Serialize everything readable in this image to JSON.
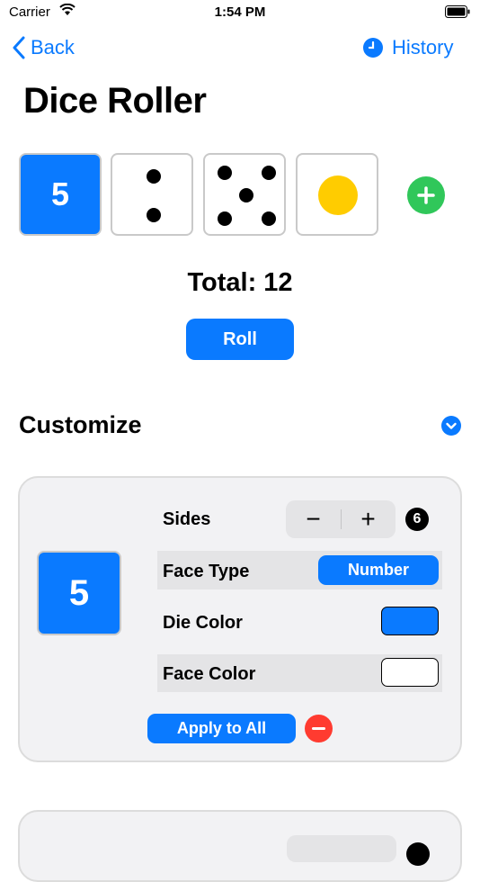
{
  "status": {
    "carrier": "Carrier",
    "time": "1:54 PM"
  },
  "nav": {
    "back_label": "Back",
    "history_label": "History"
  },
  "title": "Dice Roller",
  "dice": [
    {
      "type": "number",
      "value": "5",
      "color": "#0a7aff"
    },
    {
      "type": "pips",
      "value": 2
    },
    {
      "type": "pips",
      "value": 5
    },
    {
      "type": "symbol",
      "icon": "sun-icon",
      "color": "#ffcc00"
    }
  ],
  "total_label": "Total: 12",
  "roll_label": "Roll",
  "customize": {
    "heading": "Customize",
    "card": {
      "die_value": "5",
      "sides_label": "Sides",
      "sides_minus": "−",
      "sides_plus": "+",
      "sides_value": "6",
      "face_type_label": "Face Type",
      "face_type_value": "Number",
      "die_color_label": "Die Color",
      "die_color": "#0a7aff",
      "face_color_label": "Face Color",
      "face_color": "#ffffff",
      "apply_label": "Apply to All"
    }
  },
  "colors": {
    "accent": "#0a7aff",
    "add": "#30c75a",
    "remove": "#ff3b30",
    "card_bg": "#f2f2f4"
  }
}
